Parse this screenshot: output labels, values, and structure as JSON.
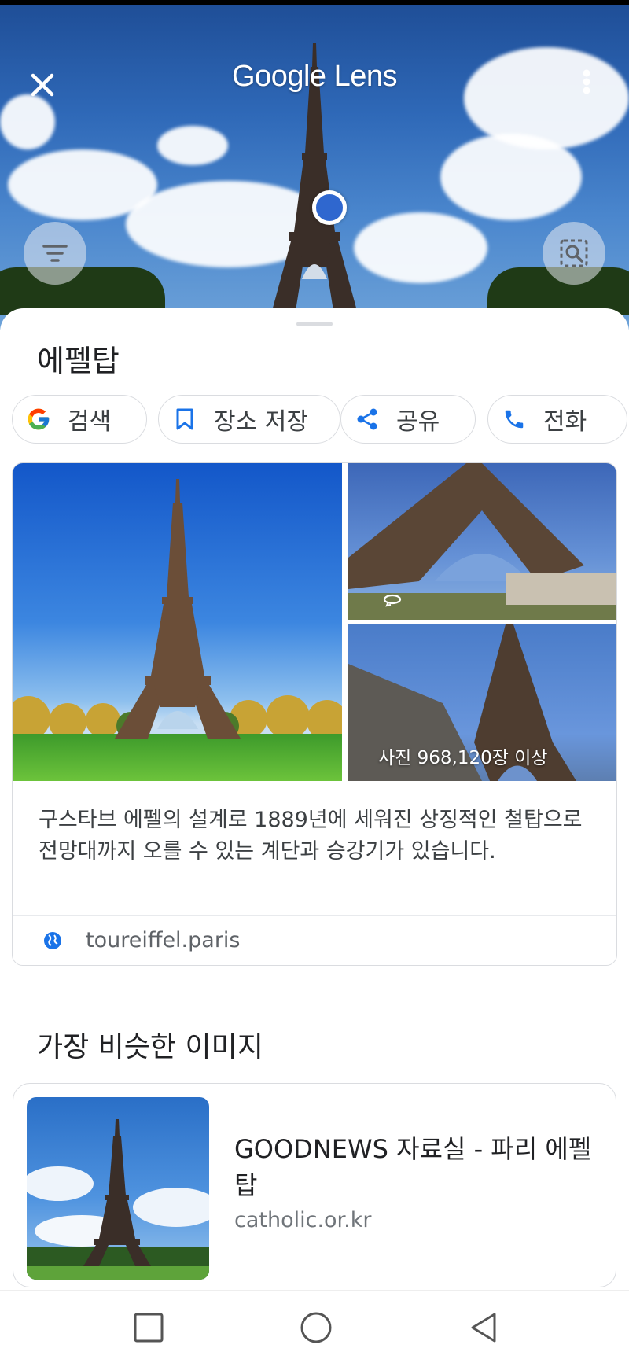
{
  "header": {
    "title": "Google Lens"
  },
  "place": {
    "title": "에펠탑"
  },
  "chips": [
    {
      "label": "검색",
      "icon": "google-g-icon"
    },
    {
      "label": "장소 저장",
      "icon": "bookmark-icon"
    },
    {
      "label": "공유",
      "icon": "share-icon"
    },
    {
      "label": "전화",
      "icon": "phone-icon"
    }
  ],
  "knowledge": {
    "photo_count": "사진 968,120장 이상",
    "description": "구스타브 에펠의 설계로 1889년에 세워진 상징적인 철탑으로 전망대까지 오를 수 있는 계단과 승강기가 있습니다.",
    "website": "toureiffel.paris"
  },
  "similar": {
    "section_title": "가장 비슷한 이미지",
    "results": [
      {
        "title": "GOODNEWS 자료실 - 파리 에펠탑",
        "domain": "catholic.or.kr"
      }
    ]
  },
  "colors": {
    "accent": "#1a73e8",
    "focus_dot": "#2f67cf",
    "chip_border": "#dadce0"
  }
}
